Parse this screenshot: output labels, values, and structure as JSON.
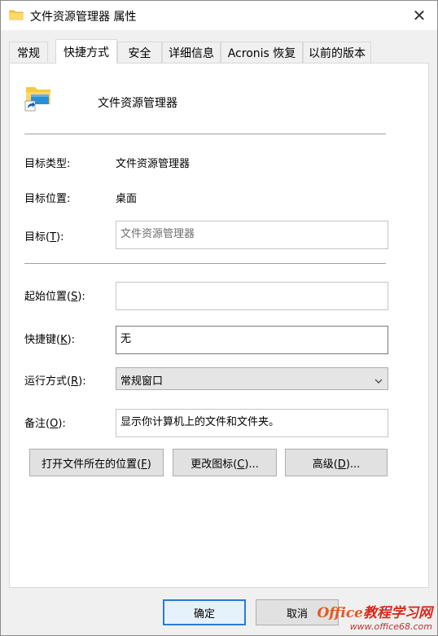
{
  "window": {
    "title": "文件资源管理器 属性",
    "close_glyph": "✕"
  },
  "tabs": [
    {
      "label": "常规"
    },
    {
      "label": "快捷方式"
    },
    {
      "label": "安全"
    },
    {
      "label": "详细信息"
    },
    {
      "label": "Acronis 恢复"
    },
    {
      "label": "以前的版本"
    }
  ],
  "active_tab": "快捷方式",
  "shortcut": {
    "name": "文件资源管理器",
    "target_type_label": "目标类型:",
    "target_type_value": "文件资源管理器",
    "target_location_label": "目标位置:",
    "target_location_value": "桌面",
    "target_label_pre": "目标(",
    "target_label_key": "T",
    "target_label_post": "):",
    "target_value": "文件资源管理器",
    "start_in_label_pre": "起始位置(",
    "start_in_label_key": "S",
    "start_in_label_post": "):",
    "start_in_value": "",
    "hotkey_label_pre": "快捷键(",
    "hotkey_label_key": "K",
    "hotkey_label_post": "):",
    "hotkey_value": "无",
    "run_label_pre": "运行方式(",
    "run_label_key": "R",
    "run_label_post": "):",
    "run_value": "常规窗口",
    "comment_label_pre": "备注(",
    "comment_label_key": "O",
    "comment_label_post": "):",
    "comment_value": "显示你计算机上的文件和文件夹。"
  },
  "actions": {
    "open_location_pre": "打开文件所在的位置(",
    "open_location_key": "F",
    "open_location_post": ")",
    "change_icon_pre": "更改图标(",
    "change_icon_key": "C",
    "change_icon_post": ")...",
    "advanced_pre": "高级(",
    "advanced_key": "D",
    "advanced_post": ")..."
  },
  "footer": {
    "ok_label": "确定",
    "cancel_label": "取消"
  },
  "watermark": {
    "brand_office": "Office",
    "brand_cn": "教程学习网",
    "site": "www.office68.com"
  },
  "icons": {
    "title_icon": "folder-icon",
    "big_icon": "file-explorer-shortcut-icon",
    "close_icon": "close-icon",
    "dropdown_icon": "chevron-down-icon"
  },
  "colors": {
    "folder_yellow": "#f6c843",
    "folder_blue": "#2b8fd6",
    "accent_border": "#2a7cd5",
    "watermark_orange": "#e25b1b"
  }
}
